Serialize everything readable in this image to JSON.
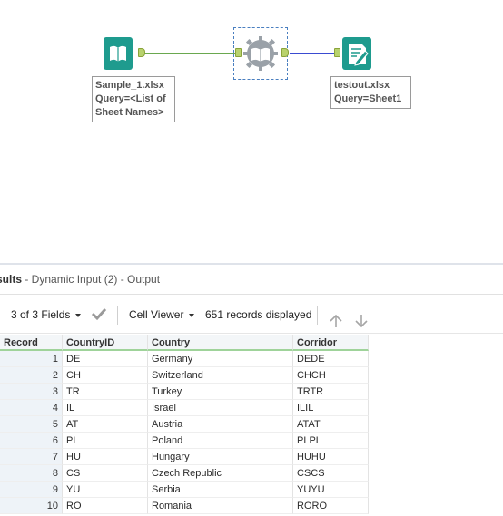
{
  "canvas": {
    "input_tool": {
      "label_lines": [
        "Sample_1.xlsx",
        "Query=<List of",
        "Sheet Names>"
      ],
      "icon": "book-icon"
    },
    "dynamic_input_tool": {
      "icon": "gear-book-icon"
    },
    "output_tool": {
      "label_lines": [
        "testout.xlsx",
        "Query=Sheet1"
      ],
      "icon": "document-pencil-icon"
    },
    "colors": {
      "input_teal": "#1e9b8e",
      "connection_green": "#6aa84f",
      "connection_blue": "#3a4bd1",
      "anchor_green": "#b8d26d"
    }
  },
  "results": {
    "title_fragment": "sults",
    "subtitle": " - Dynamic Input (2) - Output",
    "toolbar": {
      "fields_label": "3 of 3 Fields",
      "viewer_label": "Cell Viewer",
      "records_label": "651 records displayed"
    },
    "columns": [
      "Record",
      "CountryID",
      "Country",
      "Corridor"
    ],
    "rows": [
      [
        "1",
        "DE",
        "Germany",
        "DEDE"
      ],
      [
        "2",
        "CH",
        "Switzerland",
        "CHCH"
      ],
      [
        "3",
        "TR",
        "Turkey",
        "TRTR"
      ],
      [
        "4",
        "IL",
        "Israel",
        "ILIL"
      ],
      [
        "5",
        "AT",
        "Austria",
        "ATAT"
      ],
      [
        "6",
        "PL",
        "Poland",
        "PLPL"
      ],
      [
        "7",
        "HU",
        "Hungary",
        "HUHU"
      ],
      [
        "8",
        "CS",
        "Czech Republic",
        "CSCS"
      ],
      [
        "9",
        "YU",
        "Serbia",
        "YUYU"
      ],
      [
        "10",
        "RO",
        "Romania",
        "RORO"
      ]
    ]
  }
}
